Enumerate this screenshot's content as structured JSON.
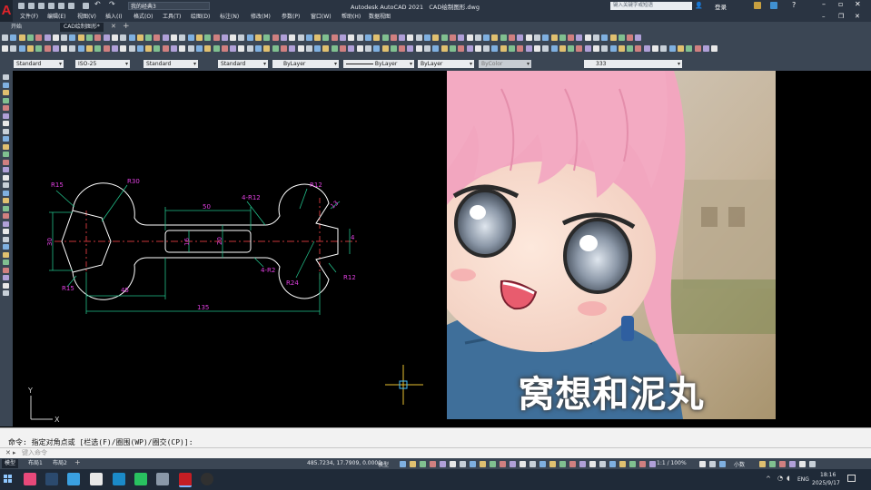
{
  "app": {
    "title": "Autodesk AutoCAD 2021",
    "document": "CAD绘制图形.dwg",
    "workspace": "我的经典3",
    "search_placeholder": "键入关键字或短语",
    "signin": "登录"
  },
  "menu": [
    "文件(F)",
    "编辑(E)",
    "视图(V)",
    "插入(I)",
    "格式(O)",
    "工具(T)",
    "绘图(D)",
    "标注(N)",
    "修改(M)",
    "参数(P)",
    "窗口(W)",
    "帮助(H)",
    "数据视图"
  ],
  "tabs": [
    {
      "label": "开始"
    },
    {
      "label": "CAD绘制图形*"
    }
  ],
  "styles": {
    "text_style": "Standard",
    "dim_style": "ISO-25",
    "table_style": "Standard",
    "multileader_style": "Standard",
    "color": "ByLayer",
    "linetype": "ByLayer",
    "lineweight": "ByLayer",
    "plot_style": "ByColor",
    "layer": "333"
  },
  "drawing": {
    "dims": {
      "r15a": "R15",
      "r30": "R30",
      "d50": "50",
      "d4r12": "4-R12",
      "r12a": "R12",
      "d13": "13",
      "d30": "30",
      "d16": "16",
      "d20": "20",
      "d4": "4",
      "d45": "45",
      "d135": "135",
      "d4r2": "4-R2",
      "r24": "R24",
      "r12b": "R12",
      "r15b": "R15"
    },
    "ucs_x": "X",
    "ucs_y": "Y"
  },
  "sticker": {
    "caption": "窝想和泥丸"
  },
  "command": {
    "history": "命令:  指定对角点或  [栏选(F)/圈围(WP)/圈交(CP)]:",
    "placeholder": "键入命令"
  },
  "layout_tabs": [
    {
      "label": "模型"
    },
    {
      "label": "布局1"
    },
    {
      "label": "布局2"
    }
  ],
  "status": {
    "coords": "485.7234, 17.7909, 0.0000",
    "model": "模型",
    "scale": "1:1 / 100%",
    "units": "小数"
  },
  "taskbar": {
    "lang": "ENG",
    "time": "18:16",
    "date": "2025/9/17"
  },
  "colors": {
    "dim": "#e040e0",
    "dim_line": "#22c08a",
    "outline": "#ffffff",
    "center": "#c8363a",
    "cursor": "#e8c030",
    "cursor_box": "#44c0ff"
  }
}
